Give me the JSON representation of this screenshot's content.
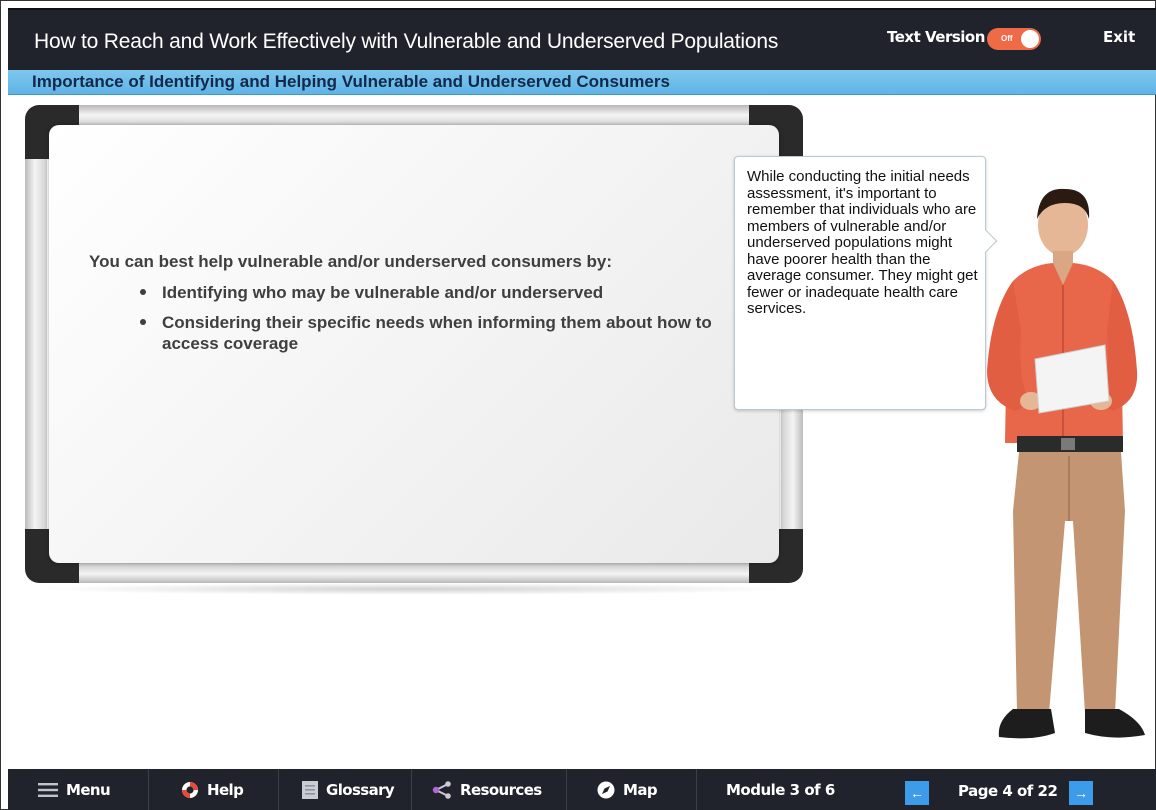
{
  "header": {
    "title": "How to Reach and Work Effectively with Vulnerable and Underserved Populations",
    "text_version_label": "Text Version",
    "toggle_state": "Off",
    "exit_label": "Exit"
  },
  "subheader": {
    "title": "Importance of Identifying and Helping Vulnerable and Underserved Consumers"
  },
  "board": {
    "intro": "You can best help vulnerable and/or underserved consumers by:",
    "bullets": [
      "Identifying who may be vulnerable and/or underserved",
      "Considering their specific needs when informing them about how to access coverage"
    ]
  },
  "bubble": {
    "text": "While conducting the initial needs assessment, it's important to remember that individuals who are members of vulnerable and/or underserved populations might have poorer health than the average consumer. They might get fewer or inadequate health care services."
  },
  "footer": {
    "menu": "Menu",
    "help": "Help",
    "glossary": "Glossary",
    "resources": "Resources",
    "map": "Map",
    "module": "Module 3 of 6",
    "page": "Page 4 of 22",
    "prev_icon": "←",
    "next_icon": "→"
  },
  "colors": {
    "header_bg": "#20232b",
    "subheader_bg": "#6fbde9",
    "toggle": "#ef6a47",
    "nav_button": "#3d9be9"
  },
  "icons": [
    "menu-icon",
    "help-lifebuoy-icon",
    "glossary-book-icon",
    "resources-share-icon",
    "map-compass-icon",
    "arrow-left-icon",
    "arrow-right-icon"
  ]
}
